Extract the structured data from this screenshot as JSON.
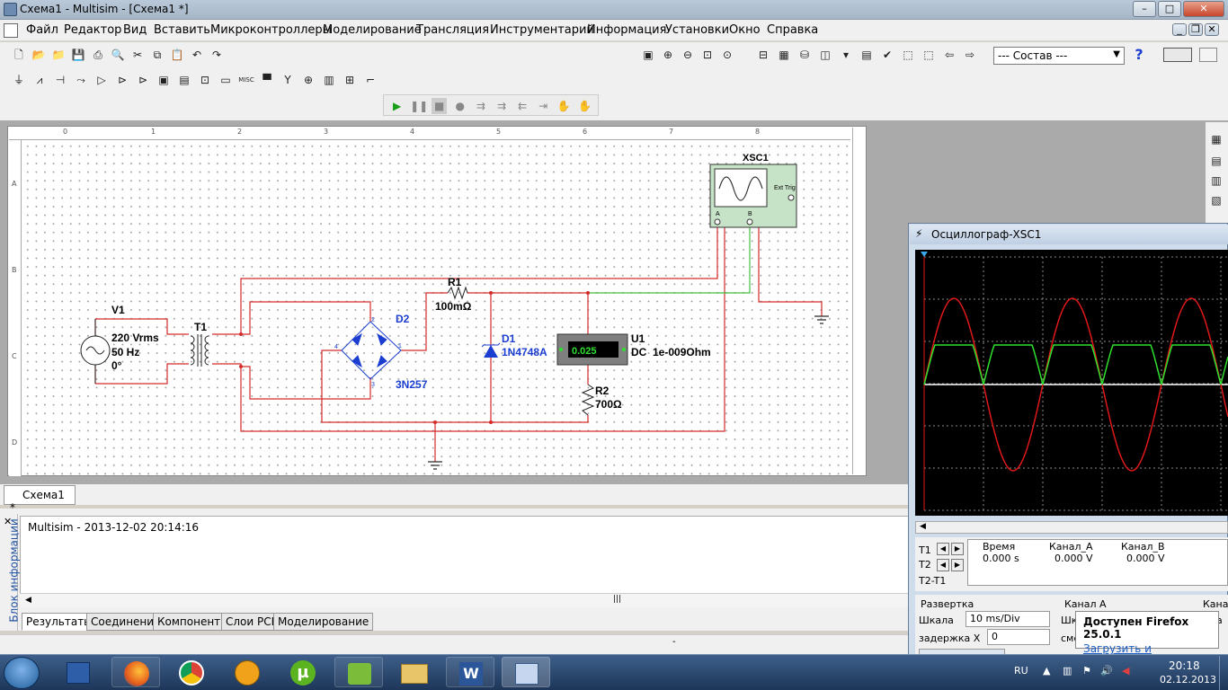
{
  "window": {
    "title": "Схема1 - Multisim - [Схема1 *]"
  },
  "menu": [
    "Файл",
    "Редактор",
    "Вид",
    "Вставить",
    "Микроконтроллеры",
    "Моделирование",
    "Трансляция",
    "Инструментарий",
    "Информация",
    "Установки",
    "Окно",
    "Справка"
  ],
  "toolbar": {
    "combo_value": "--- Состав ---"
  },
  "schematic": {
    "ruler_cols": [
      "0",
      "1",
      "2",
      "3",
      "4",
      "5",
      "6",
      "7",
      "8"
    ],
    "ruler_rows": [
      "A",
      "B",
      "C",
      "D"
    ],
    "source": {
      "name": "V1",
      "voltage": "220 Vrms",
      "freq": "50 Hz",
      "phase": "0°"
    },
    "transformer": {
      "name": "T1"
    },
    "bridge": {
      "name": "D2",
      "part": "3N257",
      "pin1": "1",
      "pin2": "2",
      "pin3": "3",
      "pin4": "4"
    },
    "r1": {
      "name": "R1",
      "value": "100mΩ"
    },
    "zener": {
      "name": "D1",
      "part": "1N4748A"
    },
    "meter": {
      "name": "U1",
      "reading": "0.025",
      "mode": "DC",
      "impedance": "1e-009Ohm"
    },
    "r2": {
      "name": "R2",
      "value": "700Ω"
    },
    "scope_block": {
      "name": "XSC1",
      "ext_trig": "Ext Trig",
      "chA": "A",
      "chB": "B"
    }
  },
  "tabs": {
    "schematic_tab": "Схема1 *"
  },
  "info": {
    "side_title": "Блок информации",
    "log_line": "Multisim  -  2013-12-02 20:14:16",
    "bottom_tabs": [
      "Результаты",
      "Соедине­ния",
      "Компоненты",
      "Слои PCB",
      "Моделирование"
    ]
  },
  "scope": {
    "title": "Осциллограф-XSC1",
    "readout_headers": [
      "Время",
      "Канал_A",
      "Канал_B"
    ],
    "readout_values": [
      "0.000 s",
      "0.000 V",
      "0.000 V"
    ],
    "cursor_labels": [
      "T1",
      "T2",
      "T2-T1"
    ],
    "sweep_label": "Развертка",
    "scale_label": "Шкала",
    "scale_value": "10 ms/Div",
    "xdelay_label": "задержка X",
    "xdelay_value": "0",
    "chA_label": "Канал A",
    "chA_scale_label": "Шк",
    "chA_offset_label": "сме",
    "chB_label": "Кана",
    "chB_scale_label": "ла"
  },
  "notify": {
    "title": "Доступен Firefox 25.0.1",
    "link": "Загрузить и установить..."
  },
  "tray": {
    "lang": "RU",
    "time": "20:18",
    "date": "02.12.2013"
  },
  "colors": {
    "wire_red": "#d42a2a",
    "wire_green": "#3fbf3f",
    "trace_red": "#e01818",
    "trace_green": "#2fe02f",
    "accent_blue": "#1b3ed1"
  }
}
